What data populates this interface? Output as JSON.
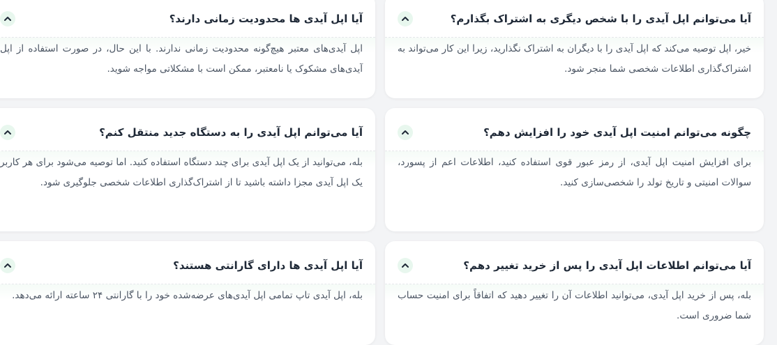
{
  "faq": [
    {
      "question": "آیا می‌توانم اپل آیدی را با شخص دیگری به اشتراک بگذارم؟",
      "answer": "خیر، اپل توصیه می‌کند که اپل آیدی را با دیگران به اشتراک نگذارید، زیرا این کار می‌تواند به اشتراک‌گذاری اطلاعات شخصی شما منجر شود."
    },
    {
      "question": "آیا اپل آیدی ها محدودیت زمانی دارند؟",
      "answer": "اپل آیدی‌های معتبر هیچ‌گونه محدودیت زمانی ندارند. با این حال، در صورت استفاده از اپل آیدی‌های مشکوک یا نامعتبر، ممکن است با مشکلاتی مواجه شوید."
    },
    {
      "question": "چگونه می‌توانم امنیت اپل آیدی خود را افزایش دهم؟",
      "answer": "برای افزایش امنیت اپل آیدی، از رمز عبور قوی استفاده کنید، اطلاعات اعم از پسورد، سوالات امنیتی و تاریخ تولد را شخصی‌سازی کنید."
    },
    {
      "question": "آیا می‌توانم اپل آیدی را به دستگاه جدید منتقل کنم؟",
      "answer": "بله، می‌توانید از یک اپل آیدی برای چند دستگاه استفاده کنید. اما توصیه می‌شود برای هر کاربر یک اپل آیدی مجزا داشته باشید تا از اشتراک‌گذاری اطلاعات شخصی جلوگیری شود."
    },
    {
      "question": "آیا می‌توانم اطلاعات اپل آیدی را پس از خرید تغییر دهم؟",
      "answer": "بله، پس از خرید اپل آیدی، می‌توانید اطلاعات آن را تغییر دهید که اتفاقاً برای امنیت حساب شما ضروری است."
    },
    {
      "question": "آیا اپل آیدی ها دارای گارانتی هستند؟",
      "answer": "بله، اپل آیدی تاپ تمامی اپل آیدی‌های عرضه‌شده خود را با گارانتی ۲۴ ساعته ارائه می‌دهد."
    }
  ],
  "icons": {
    "toggle": "chevron-up-icon"
  },
  "colors": {
    "toggle_bg": "#e8f7ee",
    "chevron": "#1f2937",
    "question_text": "#1f2937",
    "answer_text": "#4b5563"
  }
}
